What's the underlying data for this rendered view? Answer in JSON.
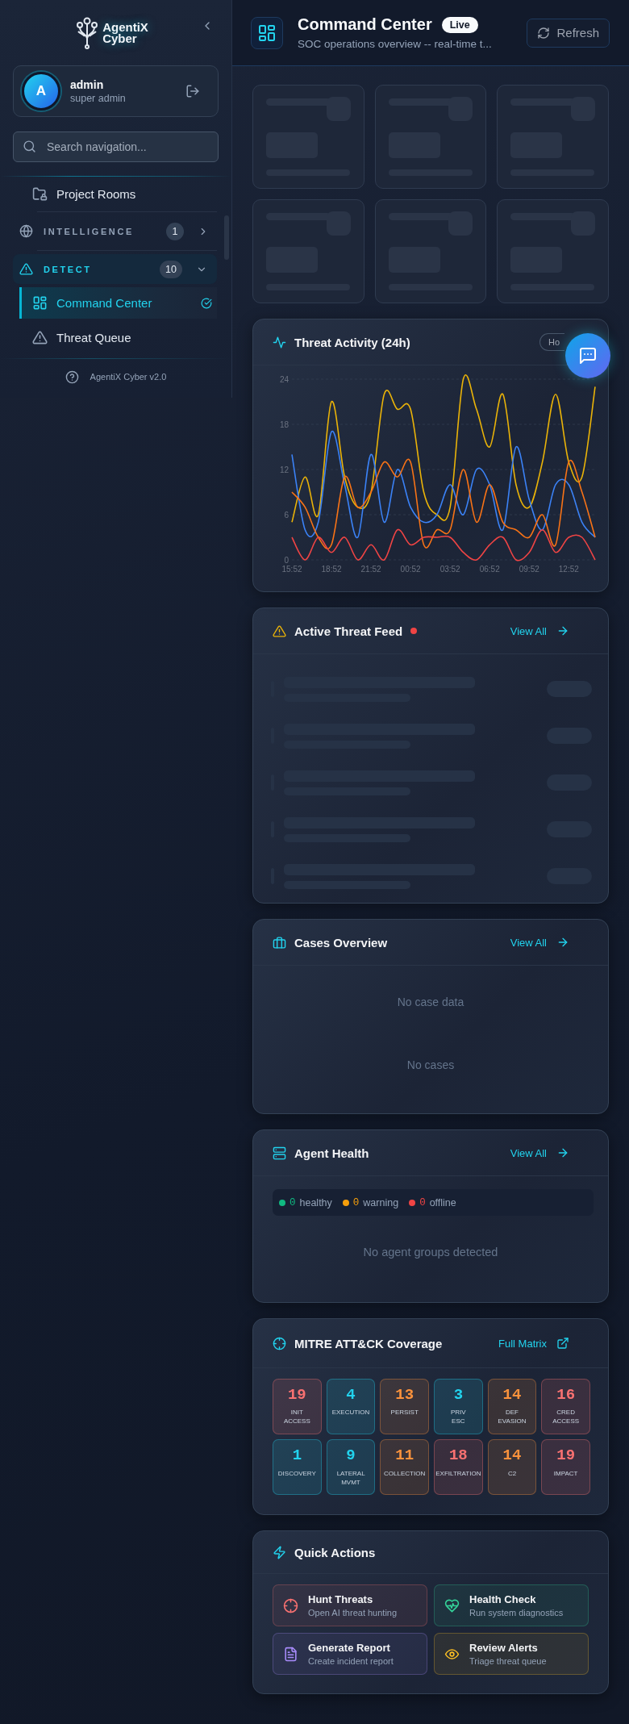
{
  "sidebar": {
    "logo": {
      "line_1": "AgentiX",
      "line_2": "Cyber"
    },
    "user": {
      "initial": "A",
      "name": "admin",
      "role": "super admin"
    },
    "search": {
      "placeholder": "Search navigation..."
    },
    "nav": [
      {
        "kind": "item",
        "label": "Project Rooms",
        "selected": false
      },
      {
        "kind": "section",
        "label": "INTELLIGENCE",
        "count": "1",
        "expanded": false
      },
      {
        "kind": "section",
        "label": "DETECT",
        "count": "10",
        "expanded": true,
        "children": [
          {
            "label": "Command Center",
            "selected": true
          },
          {
            "label": "Threat Queue",
            "selected": false
          }
        ]
      }
    ],
    "footer": "AgentiX Cyber v2.0"
  },
  "header": {
    "title": "Command Center",
    "badge": "Live",
    "subtitle": "SOC operations overview -- real-time t...",
    "refresh_button": "Refresh"
  },
  "stats": {
    "loading": true
  },
  "threat_activity": {
    "title": "Threat Activity (24h)",
    "range_button": "Ho",
    "chart_data": {
      "type": "line",
      "grid": true,
      "categories": [
        "15:52",
        null,
        null,
        "18:52",
        null,
        null,
        "21:52",
        null,
        null,
        "00:52",
        null,
        null,
        "03:52",
        null,
        null,
        "06:52",
        null,
        null,
        "09:52",
        null,
        null,
        "12:52",
        null,
        null
      ],
      "series": [
        {
          "color": "#eab308",
          "values": [
            5,
            11,
            6,
            21,
            11,
            7,
            9,
            22,
            20,
            20,
            9,
            6,
            7,
            24,
            20,
            15,
            22,
            10,
            7,
            13,
            22,
            13,
            11,
            23
          ]
        },
        {
          "color": "#3b82f6",
          "values": [
            14,
            4,
            5,
            17,
            10,
            3,
            14,
            5,
            12,
            7,
            5,
            6,
            10,
            6,
            12,
            10,
            4,
            15,
            8,
            4,
            10,
            10,
            5,
            3
          ]
        },
        {
          "color": "#f97316",
          "values": [
            9,
            7,
            3,
            2,
            11,
            7,
            9,
            13,
            11,
            13,
            2,
            4,
            4,
            12,
            5,
            10,
            5,
            4,
            3,
            6,
            2,
            13,
            9,
            3
          ]
        },
        {
          "color": "#ef4444",
          "values": [
            3,
            0,
            3,
            1,
            3,
            0,
            2,
            0,
            4,
            2,
            3,
            3,
            3,
            1,
            0,
            2,
            3,
            0,
            1,
            4,
            1,
            3,
            3,
            0
          ]
        }
      ],
      "ylim": [
        0,
        24
      ],
      "yticks": [
        0,
        6,
        12,
        18,
        24
      ]
    }
  },
  "threat_feed": {
    "title": "Active Threat Feed",
    "live": true,
    "link": "View All",
    "loading": true
  },
  "cases": {
    "title": "Cases Overview",
    "link": "View All",
    "chart_empty": "No case data",
    "list_empty": "No cases"
  },
  "agent_health": {
    "title": "Agent Health",
    "link": "View All",
    "summary": [
      {
        "count": "0",
        "label": "healthy",
        "color": "#10b981"
      },
      {
        "count": "0",
        "label": "warning",
        "color": "#f59e0b"
      },
      {
        "count": "0",
        "label": "offline",
        "color": "#ef4444"
      }
    ],
    "empty": "No agent groups detected"
  },
  "mitre": {
    "title": "MITRE ATT&CK Coverage",
    "link": "Full Matrix",
    "tactics": [
      {
        "count": "19",
        "label": "INIT ACCESS",
        "color": "#f87171"
      },
      {
        "count": "4",
        "label": "EXECUTION",
        "color": "#22d3ee"
      },
      {
        "count": "13",
        "label": "PERSIST",
        "color": "#fb923c"
      },
      {
        "count": "3",
        "label": "PRIV ESC",
        "color": "#22d3ee"
      },
      {
        "count": "14",
        "label": "DEF EVASION",
        "color": "#fb923c"
      },
      {
        "count": "16",
        "label": "CRED ACCESS",
        "color": "#f87171"
      },
      {
        "count": "1",
        "label": "DISCOVERY",
        "color": "#22d3ee"
      },
      {
        "count": "9",
        "label": "LATERAL MVMT",
        "color": "#22d3ee"
      },
      {
        "count": "11",
        "label": "COLLECTION",
        "color": "#fb923c"
      },
      {
        "count": "18",
        "label": "EXFILTRATION",
        "color": "#f87171"
      },
      {
        "count": "14",
        "label": "C2",
        "color": "#fb923c"
      },
      {
        "count": "19",
        "label": "IMPACT",
        "color": "#f87171"
      }
    ]
  },
  "quick_actions": {
    "title": "Quick Actions",
    "actions": [
      {
        "title": "Hunt Threats",
        "subtitle": "Open AI threat hunting",
        "color": "#f87171"
      },
      {
        "title": "Health Check",
        "subtitle": "Run system diagnostics",
        "color": "#34d399"
      },
      {
        "title": "Generate Report",
        "subtitle": "Create incident report",
        "color": "#a78bfa"
      },
      {
        "title": "Review Alerts",
        "subtitle": "Triage threat queue",
        "color": "#fbbf24"
      }
    ]
  }
}
